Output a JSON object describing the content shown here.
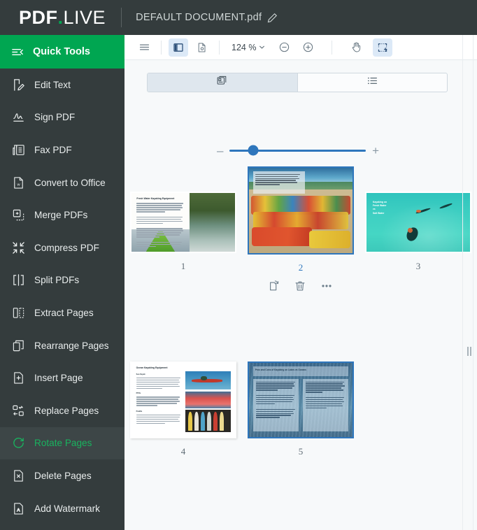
{
  "brand": {
    "part1": "PDF",
    "dot": ".",
    "part2": "LIVE"
  },
  "header": {
    "document_title": "DEFAULT DOCUMENT.pdf",
    "edit_title_icon": "pencil-icon"
  },
  "sidebar": {
    "quick_tools_label": "Quick Tools",
    "quick_tools_icon": "collapse-menu-icon",
    "active_item": "Rotate Pages",
    "items": [
      {
        "label": "Edit Text",
        "icon": "edit-text-icon",
        "active": false
      },
      {
        "label": "Sign PDF",
        "icon": "signature-icon",
        "active": false
      },
      {
        "label": "Fax PDF",
        "icon": "fax-icon",
        "active": false
      },
      {
        "label": "Convert to Office",
        "icon": "word-document-icon",
        "active": false
      },
      {
        "label": "Merge PDFs",
        "icon": "merge-icon",
        "active": false
      },
      {
        "label": "Compress PDF",
        "icon": "compress-icon",
        "active": false
      },
      {
        "label": "Split PDFs",
        "icon": "split-icon",
        "active": false
      },
      {
        "label": "Extract Pages",
        "icon": "extract-pages-icon",
        "active": false
      },
      {
        "label": "Rearrange Pages",
        "icon": "rearrange-pages-icon",
        "active": false
      },
      {
        "label": "Insert Page",
        "icon": "insert-page-icon",
        "active": false
      },
      {
        "label": "Replace Pages",
        "icon": "replace-pages-icon",
        "active": false
      },
      {
        "label": "Rotate Pages",
        "icon": "rotate-icon",
        "active": true
      },
      {
        "label": "Delete Pages",
        "icon": "delete-page-icon",
        "active": false
      },
      {
        "label": "Add Watermark",
        "icon": "watermark-icon",
        "active": false
      }
    ]
  },
  "toolbar": {
    "menu_icon": "hamburger-menu-icon",
    "sidebar_toggle_icon": "sidebar-panel-icon",
    "sidebar_toggle_active": true,
    "page_settings_icon": "page-settings-icon",
    "zoom_value": "124 %",
    "zoom_caret_icon": "chevron-down-icon",
    "zoom_out_icon": "zoom-out-icon",
    "zoom_in_icon": "zoom-in-icon",
    "pan_icon": "hand-pan-icon",
    "select_area_icon": "select-area-icon",
    "select_area_active": true
  },
  "view_toggle": {
    "thumbnail_view_icon": "thumbnail-grid-icon",
    "thumbnail_view_active": true,
    "list_view_icon": "list-view-icon",
    "list_view_active": false
  },
  "size_slider": {
    "minus_label": "–",
    "plus_label": "+",
    "value_percent": 17
  },
  "page_actions": {
    "rotate_icon": "rotate-page-icon",
    "delete_icon": "trash-icon",
    "more_icon": "more-options-icon"
  },
  "thumbnails": [
    {
      "number": "1",
      "selected": false,
      "heading": "Fresh Water Kayaking Equipment",
      "orientation": "landscape",
      "has_actions": false
    },
    {
      "number": "2",
      "selected": true,
      "heading": "",
      "orientation": "landscape",
      "has_actions": true
    },
    {
      "number": "3",
      "selected": false,
      "heading": "Kayaking on\nFresh Water\nvs\nSalt Water",
      "heading_lines": [
        "Kayaking on",
        "Fresh Water",
        "vs",
        "Salt Water"
      ],
      "orientation": "landscape",
      "has_actions": false
    },
    {
      "number": "4",
      "selected": false,
      "heading": "Ocean Kayaking Equipment",
      "subheads": [
        "Sea Kayak",
        "PFDs",
        "Paddle"
      ],
      "orientation": "landscape",
      "has_actions": false
    },
    {
      "number": "5",
      "selected": true,
      "heading": "Pros and Cons of Kayaking on Lakes vs Oceans",
      "orientation": "landscape",
      "has_actions": false
    }
  ],
  "resizer": {
    "icon": "drag-handle-icon"
  },
  "colors": {
    "brand_green": "#00a651",
    "header_dark": "#343c3d",
    "accent_blue": "#2e76bc",
    "active_blue_bg": "#dce9f7",
    "canvas": "#f7f9fa"
  }
}
